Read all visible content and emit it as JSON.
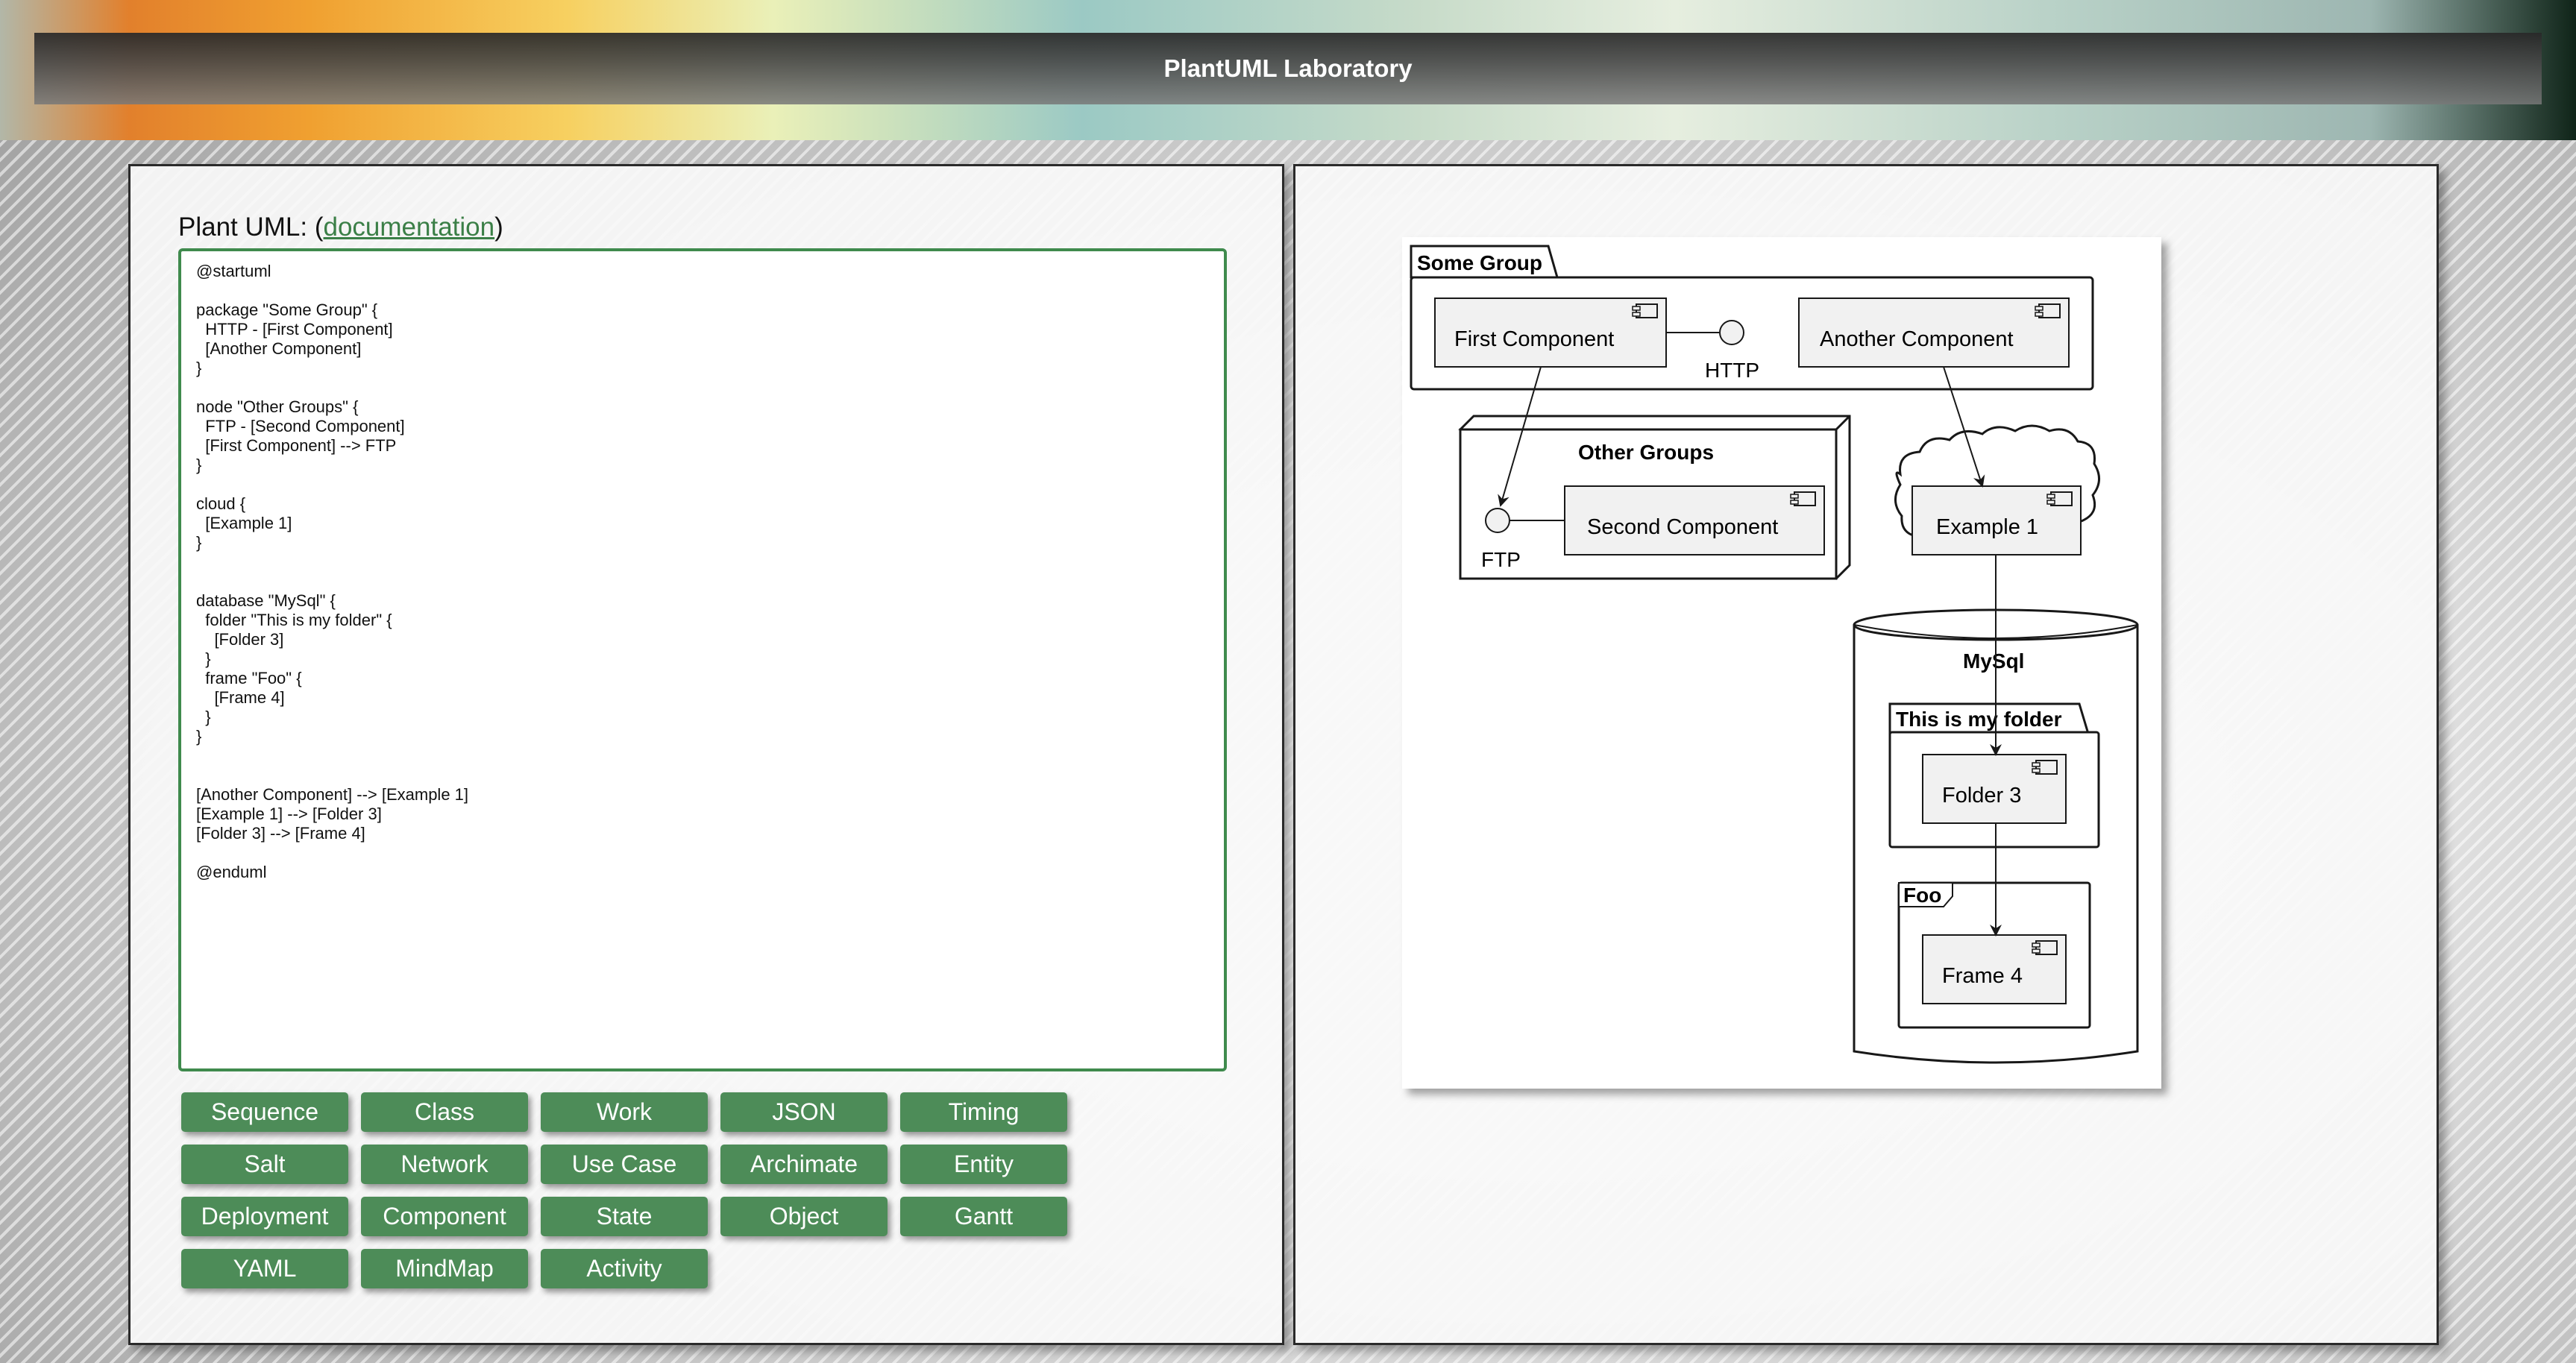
{
  "app": {
    "title": "PlantUML Laboratory"
  },
  "editor": {
    "label_prefix": "Plant UML: (",
    "doc_link": "documentation",
    "label_suffix": ")",
    "code": "@startuml\n\npackage \"Some Group\" {\n  HTTP - [First Component]\n  [Another Component]\n}\n\nnode \"Other Groups\" {\n  FTP - [Second Component]\n  [First Component] --> FTP\n}\n\ncloud {\n  [Example 1]\n}\n\n\ndatabase \"MySql\" {\n  folder \"This is my folder\" {\n    [Folder 3]\n  }\n  frame \"Foo\" {\n    [Frame 4]\n  }\n}\n\n\n[Another Component] --> [Example 1]\n[Example 1] --> [Folder 3]\n[Folder 3] --> [Frame 4]\n\n@enduml"
  },
  "buttons": [
    "Sequence",
    "Class",
    "Work",
    "JSON",
    "Timing",
    "Salt",
    "Network",
    "Use Case",
    "Archimate",
    "Entity",
    "Deployment",
    "Component",
    "State",
    "Object",
    "Gantt",
    "YAML",
    "MindMap",
    "Activity"
  ],
  "diagram": {
    "some_group": "Some Group",
    "first_component": "First Component",
    "http": "HTTP",
    "another_component": "Another Component",
    "other_groups": "Other Groups",
    "ftp": "FTP",
    "second_component": "Second Component",
    "example1": "Example 1",
    "mysql": "MySql",
    "folder_label": "This is my folder",
    "folder3": "Folder 3",
    "foo": "Foo",
    "frame4": "Frame 4"
  }
}
